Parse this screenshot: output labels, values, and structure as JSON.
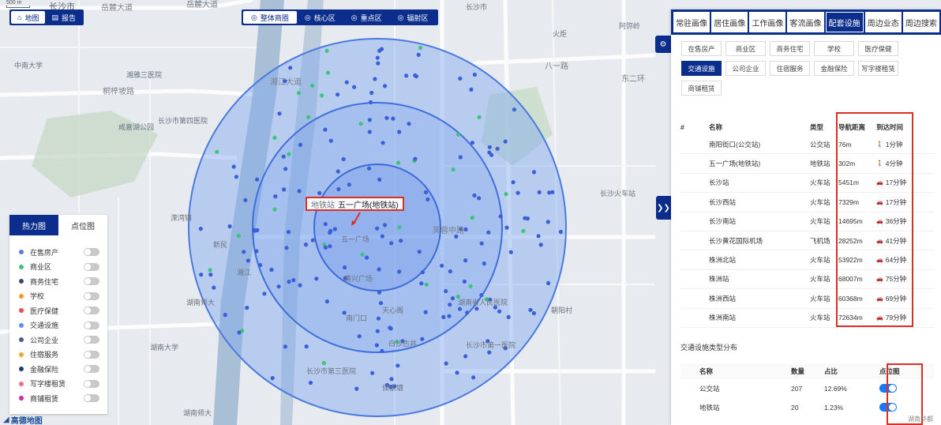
{
  "scale": {
    "label": "500 m"
  },
  "view_switch": {
    "items": [
      {
        "label": "地图",
        "icon": "map-icon",
        "active": true
      },
      {
        "label": "报告",
        "icon": "report-icon",
        "active": false
      }
    ]
  },
  "range_tabs": {
    "items": [
      {
        "label": "整体商圈",
        "icon": "target-icon",
        "active": true
      },
      {
        "label": "核心区",
        "icon": "target-icon",
        "active": false
      },
      {
        "label": "重点区",
        "icon": "target-icon",
        "active": false
      },
      {
        "label": "辐射区",
        "icon": "target-icon",
        "active": false
      }
    ]
  },
  "map": {
    "target": {
      "type": "地铁站",
      "name": "五一广场(地铁站)"
    },
    "labels": [
      {
        "t": "长沙市",
        "c": "normal"
      },
      {
        "t": "岳麓大道",
        "c": "road"
      },
      {
        "t": "岳麓大道",
        "c": "road"
      },
      {
        "t": "长沙市",
        "c": "normal"
      },
      {
        "t": "湘江大道",
        "c": "road"
      },
      {
        "t": "中南大学",
        "c": "normal"
      },
      {
        "t": "湘雅三医院",
        "c": "normal"
      },
      {
        "t": "长沙市第四医院",
        "c": "normal"
      },
      {
        "t": "咸嘉湖公园",
        "c": "normal"
      },
      {
        "t": "桐梓坡路",
        "c": "road"
      },
      {
        "t": "溁湾镇",
        "c": "normal"
      },
      {
        "t": "新民",
        "c": "normal"
      },
      {
        "t": "湖南师大",
        "c": "normal"
      },
      {
        "t": "湖南大学",
        "c": "normal"
      },
      {
        "t": "湖南师大",
        "c": "normal"
      },
      {
        "t": "五一广场",
        "c": "normal"
      },
      {
        "t": "黄兴广场",
        "c": "normal"
      },
      {
        "t": "长沙火车站",
        "c": "normal"
      },
      {
        "t": "东二环",
        "c": "road"
      },
      {
        "t": "芙蓉中路",
        "c": "road"
      },
      {
        "t": "八一路",
        "c": "road"
      },
      {
        "t": "长沙市第三医院",
        "c": "normal"
      },
      {
        "t": "侯家塘",
        "c": "normal"
      },
      {
        "t": "南门口",
        "c": "normal"
      },
      {
        "t": "天心阁",
        "c": "normal"
      },
      {
        "t": "白沙古井",
        "c": "normal"
      },
      {
        "t": "长沙市第一医院",
        "c": "normal"
      },
      {
        "t": "湖南省人民医院",
        "c": "normal"
      },
      {
        "t": "朝阳村",
        "c": "normal"
      },
      {
        "t": "阿弥岭",
        "c": "normal"
      },
      {
        "t": "火炬",
        "c": "normal"
      },
      {
        "t": "湘江",
        "c": "normal"
      },
      {
        "t": "高德地图",
        "c": "normal"
      }
    ]
  },
  "legend": {
    "tabs": [
      {
        "label": "热力图",
        "active": true
      },
      {
        "label": "点位图",
        "active": false
      }
    ],
    "items": [
      {
        "name": "在售房产",
        "color": "#5b7bd5"
      },
      {
        "name": "商业区",
        "color": "#3cc47c"
      },
      {
        "name": "商务住宅",
        "color": "#3b4a6b"
      },
      {
        "name": "学校",
        "color": "#f59a23"
      },
      {
        "name": "医疗保健",
        "color": "#e84e4e"
      },
      {
        "name": "交通设施",
        "color": "#5b8ff9"
      },
      {
        "name": "公司企业",
        "color": "#4a5a8a"
      },
      {
        "name": "住宿服务",
        "color": "#f5a623"
      },
      {
        "name": "金融保险",
        "color": "#1f3b7a"
      },
      {
        "name": "写字楼租赁",
        "color": "#f26d7d"
      },
      {
        "name": "商铺租赁",
        "color": "#d6289a"
      }
    ]
  },
  "right_panel": {
    "tabs": [
      {
        "label": "常驻画像",
        "active": false
      },
      {
        "label": "居住画像",
        "active": false
      },
      {
        "label": "工作画像",
        "active": false
      },
      {
        "label": "客流画像",
        "active": false
      },
      {
        "label": "配套设施",
        "active": true
      },
      {
        "label": "周边业态",
        "active": false
      },
      {
        "label": "周边搜索",
        "active": false
      }
    ],
    "categories": [
      {
        "label": "在售房产",
        "active": false
      },
      {
        "label": "商业区",
        "active": false
      },
      {
        "label": "商务住宅",
        "active": false
      },
      {
        "label": "学校",
        "active": false
      },
      {
        "label": "医疗保健",
        "active": false
      },
      {
        "label": "交通设施",
        "active": true
      },
      {
        "label": "公司企业",
        "active": false
      },
      {
        "label": "住宿服务",
        "active": false
      },
      {
        "label": "金融保险",
        "active": false
      },
      {
        "label": "写字楼租赁",
        "active": false
      },
      {
        "label": "商铺租赁",
        "active": false
      }
    ],
    "poi_table": {
      "headers": {
        "idx": "#",
        "name": "名称",
        "type": "类型",
        "dist": "导航距离",
        "time": "到达时间"
      },
      "rows": [
        {
          "name": "南阳街口(公交站)",
          "type": "公交站",
          "dist": "76m",
          "time": "1分钟",
          "mode": "walk"
        },
        {
          "name": "五一广场(地铁站)",
          "type": "地铁站",
          "dist": "302m",
          "time": "4分钟",
          "mode": "walk"
        },
        {
          "name": "长沙站",
          "type": "火车站",
          "dist": "5451m",
          "time": "17分钟",
          "mode": "car"
        },
        {
          "name": "长沙西站",
          "type": "火车站",
          "dist": "7329m",
          "time": "17分钟",
          "mode": "car"
        },
        {
          "name": "长沙南站",
          "type": "火车站",
          "dist": "14695m",
          "time": "36分钟",
          "mode": "car"
        },
        {
          "name": "长沙黄花国际机场",
          "type": "飞机场",
          "dist": "28252m",
          "time": "41分钟",
          "mode": "car"
        },
        {
          "name": "株洲北站",
          "type": "火车站",
          "dist": "53922m",
          "time": "64分钟",
          "mode": "car"
        },
        {
          "name": "株洲站",
          "type": "火车站",
          "dist": "68007m",
          "time": "75分钟",
          "mode": "car"
        },
        {
          "name": "株洲西站",
          "type": "火车站",
          "dist": "60368m",
          "time": "69分钟",
          "mode": "car"
        },
        {
          "name": "株洲南站",
          "type": "火车站",
          "dist": "72634m",
          "time": "79分钟",
          "mode": "car"
        }
      ]
    },
    "dist_title": "交通设施类型分布",
    "dist_table": {
      "headers": {
        "name": "名称",
        "count": "数量",
        "pct": "占比",
        "sw": "点位图"
      },
      "rows": [
        {
          "name": "公交站",
          "count": "207",
          "pct": "12.69%"
        },
        {
          "name": "地铁站",
          "count": "20",
          "pct": "1.23%"
        }
      ]
    }
  },
  "footer": {
    "logo": "高德地图",
    "watermark": "湖南华都"
  }
}
